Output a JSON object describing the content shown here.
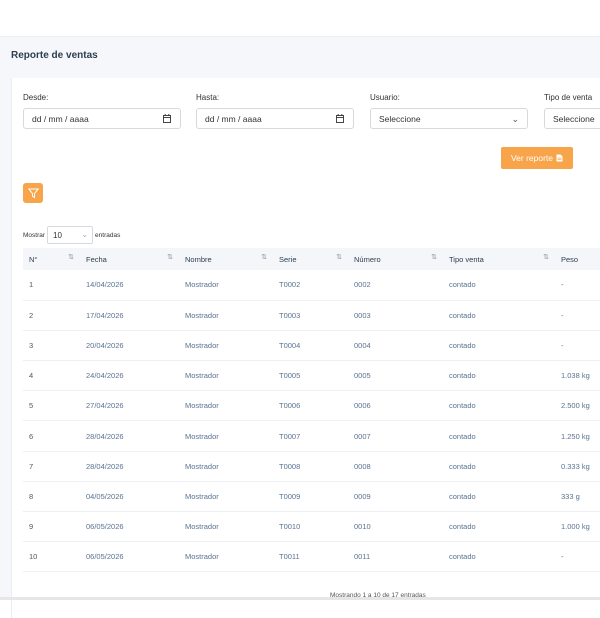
{
  "page": {
    "title": "Reporte de ventas"
  },
  "filters": {
    "desde": {
      "label": "Desde:",
      "value": "dd / mm / aaaa"
    },
    "hasta": {
      "label": "Hasta:",
      "value": "dd / mm / aaaa"
    },
    "usuario": {
      "label": "Usuario:",
      "value": "Seleccione"
    },
    "tipo_venta": {
      "label": "Tipo de venta",
      "value": "Seleccione"
    }
  },
  "buttons": {
    "ver_reporte": "Ver reporte"
  },
  "length": {
    "prefix": "Mostrar",
    "value": "10",
    "suffix": "entradas"
  },
  "table": {
    "headers": [
      "N°",
      "Fecha",
      "Nombre",
      "Serie",
      "Número",
      "Tipo venta",
      "Peso"
    ],
    "rows": [
      [
        "1",
        "14/04/2026",
        "Mostrador",
        "T0002",
        "0002",
        "contado",
        "-"
      ],
      [
        "2",
        "17/04/2026",
        "Mostrador",
        "T0003",
        "0003",
        "contado",
        "-"
      ],
      [
        "3",
        "20/04/2026",
        "Mostrador",
        "T0004",
        "0004",
        "contado",
        "-"
      ],
      [
        "4",
        "24/04/2026",
        "Mostrador",
        "T0005",
        "0005",
        "contado",
        "1.038 kg"
      ],
      [
        "5",
        "27/04/2026",
        "Mostrador",
        "T0006",
        "0006",
        "contado",
        "2.500 kg"
      ],
      [
        "6",
        "28/04/2026",
        "Mostrador",
        "T0007",
        "0007",
        "contado",
        "1.250 kg"
      ],
      [
        "7",
        "28/04/2026",
        "Mostrador",
        "T0008",
        "0008",
        "contado",
        "0.333 kg"
      ],
      [
        "8",
        "04/05/2026",
        "Mostrador",
        "T0009",
        "0009",
        "contado",
        "333 g"
      ],
      [
        "9",
        "06/05/2026",
        "Mostrador",
        "T0010",
        "0010",
        "contado",
        "1.000 kg"
      ],
      [
        "10",
        "06/05/2026",
        "Mostrador",
        "T0011",
        "0011",
        "contado",
        "-"
      ]
    ]
  },
  "footer": {
    "info": "Mostrando 1 a 10 de 17 entradas"
  },
  "colors": {
    "accent": "#f7a44a",
    "text": "#2c3e50",
    "link_text": "#5a7290"
  }
}
